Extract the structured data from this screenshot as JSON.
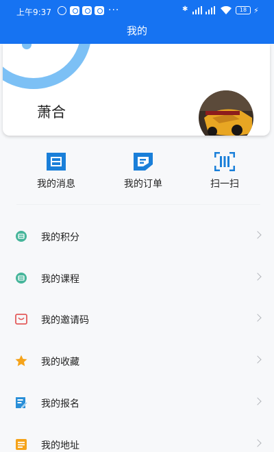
{
  "status_bar": {
    "time": "上午9:37",
    "dots": "···",
    "battery": "18"
  },
  "header": {
    "title": "我的"
  },
  "profile": {
    "username": "萧合"
  },
  "shortcuts": [
    {
      "label": "我的消息",
      "icon": "message-icon"
    },
    {
      "label": "我的订单",
      "icon": "order-icon"
    },
    {
      "label": "扫一扫",
      "icon": "scan-icon"
    }
  ],
  "menu": [
    {
      "label": "我的积分",
      "icon": "points-icon",
      "color": "#46b59a"
    },
    {
      "label": "我的课程",
      "icon": "course-icon",
      "color": "#46b59a"
    },
    {
      "label": "我的邀请码",
      "icon": "invite-code-icon",
      "color": "#e35b5b"
    },
    {
      "label": "我的收藏",
      "icon": "star-icon",
      "color": "#f5a31a"
    },
    {
      "label": "我的报名",
      "icon": "signup-icon",
      "color": "#2a8fd8"
    },
    {
      "label": "我的地址",
      "icon": "address-icon",
      "color": "#f5a31a"
    }
  ],
  "colors": {
    "primary": "#1673f2",
    "accent_light": "#7cc0f5"
  }
}
